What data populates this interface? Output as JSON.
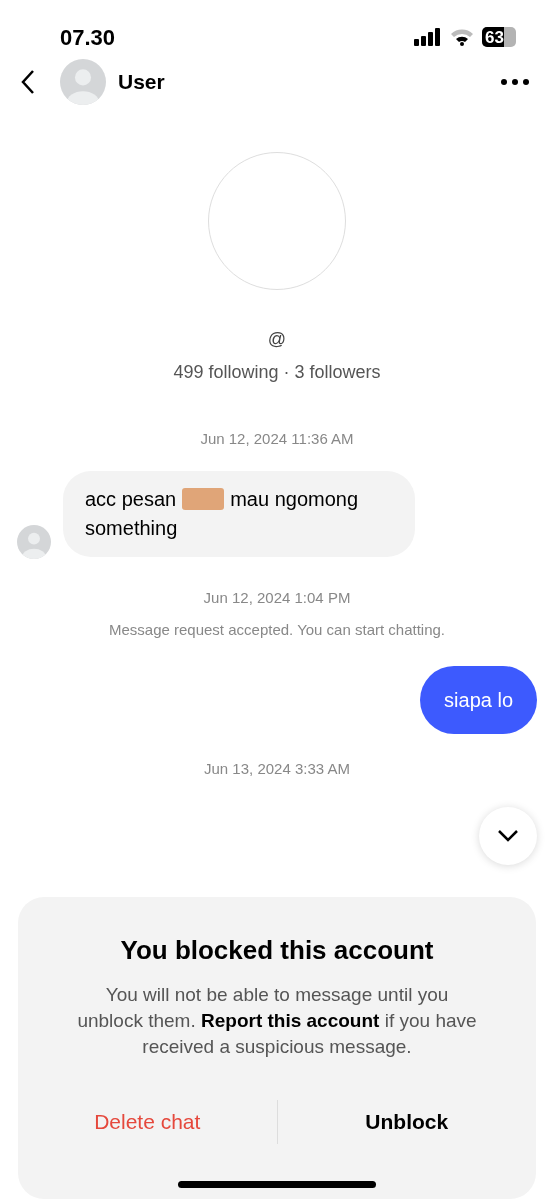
{
  "status_bar": {
    "time": "07.30",
    "battery": "63"
  },
  "header": {
    "name": "User"
  },
  "profile": {
    "handle": "@",
    "stats": "499 following · 3 followers"
  },
  "messages": [
    {
      "kind": "timestamp",
      "text": "Jun 12, 2024 11:36 AM"
    },
    {
      "kind": "incoming",
      "text_before": "acc pesan",
      "redacted": true,
      "text_after": "mau ngomong",
      "text_line_2": "something"
    },
    {
      "kind": "timestamp",
      "text": "Jun 12, 2024 1:04 PM"
    },
    {
      "kind": "system",
      "text": "Message request accepted. You can start chatting."
    },
    {
      "kind": "outgoing",
      "text": "siapa lo"
    },
    {
      "kind": "timestamp",
      "text": "Jun 13, 2024 3:33 AM"
    }
  ],
  "blocked_panel": {
    "title": "You blocked this account",
    "body": "You will not be able to message  until you unblock them. **Report this account** if you have received a suspicious message.",
    "buttons": [
      {
        "kind": "danger",
        "label": "Delete chat"
      },
      {
        "kind": "normal",
        "label": "Unblock"
      }
    ]
  }
}
